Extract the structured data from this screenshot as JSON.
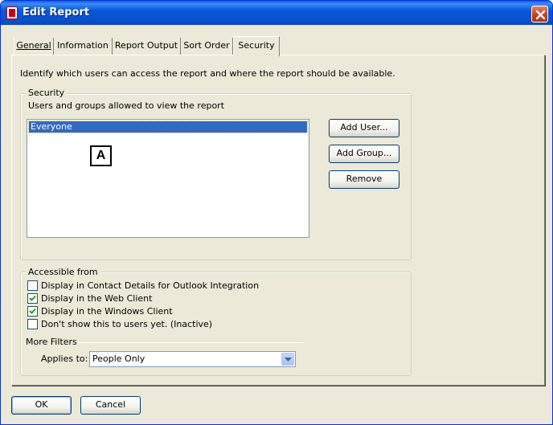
{
  "window": {
    "title": "Edit Report"
  },
  "tabs": [
    {
      "label": "General",
      "active": false
    },
    {
      "label": "Information",
      "active": false
    },
    {
      "label": "Report Output",
      "active": false
    },
    {
      "label": "Sort Order",
      "active": false
    },
    {
      "label": "Security",
      "active": true
    }
  ],
  "page": {
    "description": "Identify which users can access the report and where the report should be available."
  },
  "security": {
    "legend": "Security",
    "subtitle": "Users and groups allowed to view the report",
    "list_items": [
      "Everyone"
    ],
    "marker": "A",
    "add_user_label": "Add User...",
    "add_group_label": "Add Group...",
    "remove_label": "Remove"
  },
  "accessible": {
    "legend": "Accessible from",
    "options": [
      {
        "label": "Display in Contact Details for Outlook Integration",
        "checked": false
      },
      {
        "label": "Display in the Web Client",
        "checked": true
      },
      {
        "label": "Display in the Windows Client",
        "checked": true
      },
      {
        "label": "Don't show this to users yet. (Inactive)",
        "checked": false
      }
    ],
    "more_filters_label": "More Filters",
    "applies_to_label": "Applies to:",
    "applies_to_value": "People Only"
  },
  "footer": {
    "ok_label": "OK",
    "cancel_label": "Cancel"
  },
  "colors": {
    "titlebar": "#0a57d8",
    "dialog_bg": "#ece9d8",
    "selection": "#316ac5",
    "close_button": "#c9401a"
  }
}
